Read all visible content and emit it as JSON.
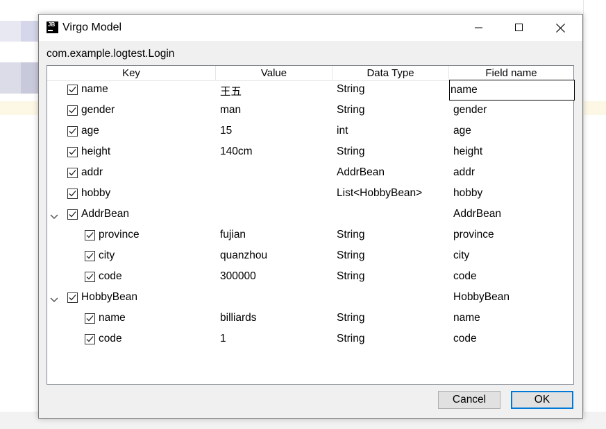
{
  "window": {
    "title": "Virgo Model",
    "icon_text": "JB"
  },
  "class_name": "com.example.logtest.Login",
  "columns": [
    "Key",
    "Value",
    "Data Type",
    "Field name"
  ],
  "rows": [
    {
      "key": "name",
      "value": "王五",
      "type": "String",
      "field": "name"
    },
    {
      "key": "gender",
      "value": "man",
      "type": "String",
      "field": "gender"
    },
    {
      "key": "age",
      "value": "15",
      "type": "int",
      "field": "age"
    },
    {
      "key": "height",
      "value": "140cm",
      "type": "String",
      "field": "height"
    },
    {
      "key": "addr",
      "value": "",
      "type": "AddrBean",
      "field": "addr"
    },
    {
      "key": "hobby",
      "value": "",
      "type": "List<HobbyBean>",
      "field": "hobby"
    },
    {
      "key": "AddrBean",
      "value": "",
      "type": "",
      "field": "AddrBean"
    },
    {
      "key": "province",
      "value": "fujian",
      "type": "String",
      "field": "province"
    },
    {
      "key": "city",
      "value": "quanzhou",
      "type": "String",
      "field": "city"
    },
    {
      "key": "code",
      "value": "300000",
      "type": "String",
      "field": "code"
    },
    {
      "key": "HobbyBean",
      "value": "",
      "type": "",
      "field": "HobbyBean"
    },
    {
      "key": "name",
      "value": "billiards",
      "type": "String",
      "field": "name"
    },
    {
      "key": "code",
      "value": "1",
      "type": "String",
      "field": "code"
    }
  ],
  "buttons": {
    "cancel": "Cancel",
    "ok": "OK"
  },
  "colors": {
    "accent": "#0078d7",
    "button_bg": "#e1e1e1",
    "dialog_bg": "#f0f0f0"
  }
}
